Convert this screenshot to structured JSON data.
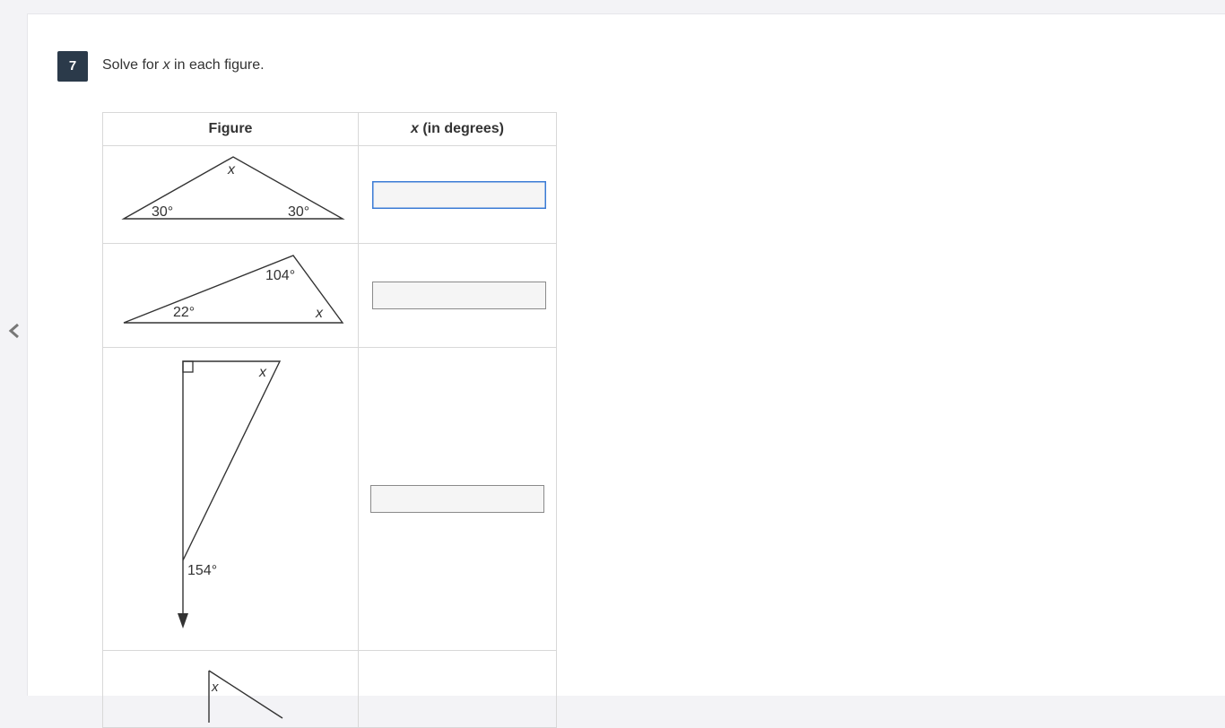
{
  "question": {
    "number": "7",
    "prompt_prefix": "Solve for ",
    "prompt_var": "x",
    "prompt_suffix": " in each figure."
  },
  "table": {
    "headers": {
      "figure": "Figure",
      "x_var": "x",
      "x_rest": " (in degrees)"
    },
    "rows": [
      {
        "labels": [
          "x",
          "30°",
          "30°"
        ],
        "answer": ""
      },
      {
        "labels": [
          "104°",
          "22°",
          "x"
        ],
        "answer": ""
      },
      {
        "labels": [
          "x",
          "154°"
        ],
        "answer": ""
      },
      {
        "labels": [
          "x"
        ]
      }
    ]
  },
  "icons": {
    "prev": "chevron-left-icon",
    "right_angle": "right-angle-marker"
  }
}
